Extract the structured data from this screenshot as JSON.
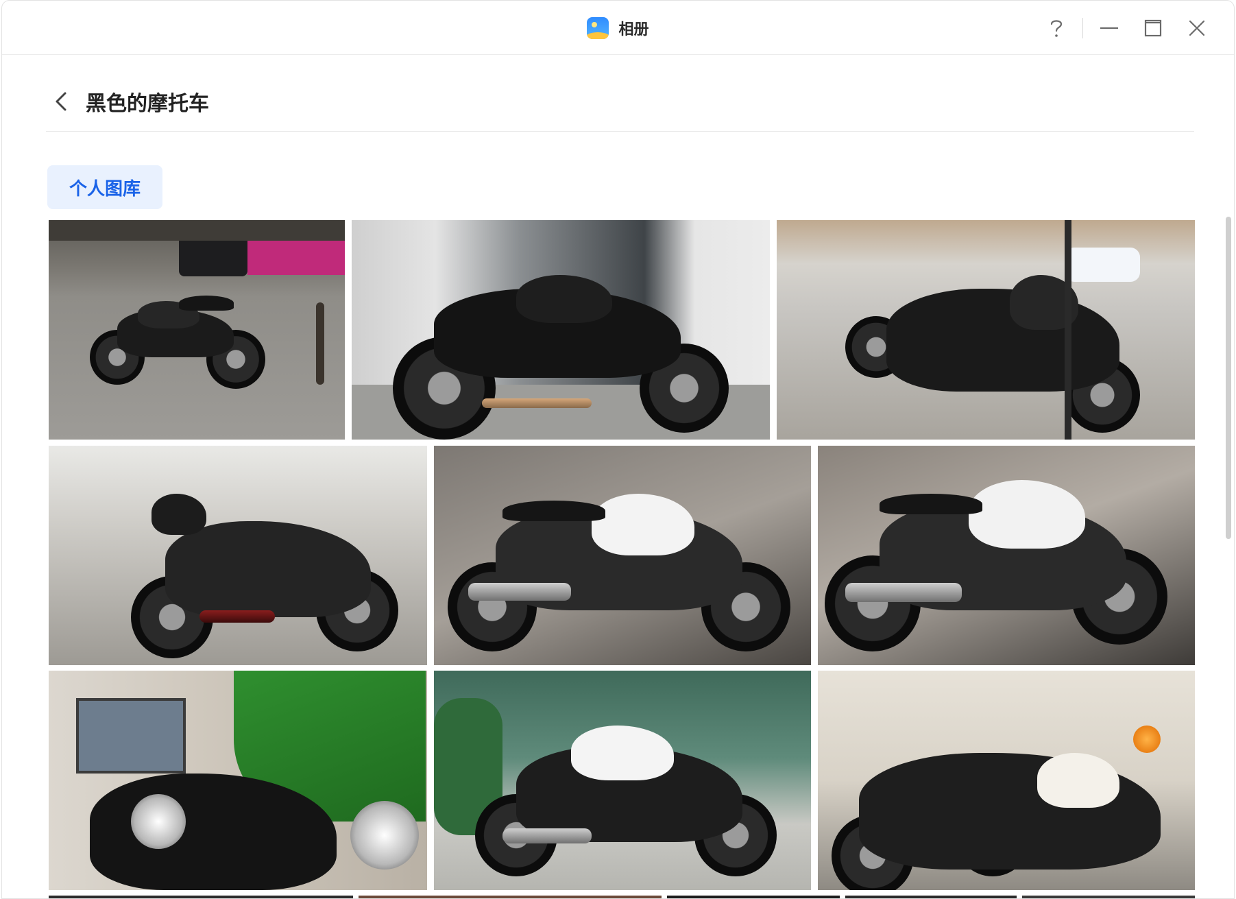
{
  "window": {
    "app_title": "相册",
    "app_icon": "photos-app-icon",
    "controls": [
      {
        "name": "help-button",
        "icon": "question-icon"
      },
      {
        "name": "minimize-button",
        "icon": "minimize-icon"
      },
      {
        "name": "maximize-button",
        "icon": "maximize-icon"
      },
      {
        "name": "close-button",
        "icon": "close-icon"
      }
    ]
  },
  "header": {
    "back_icon": "chevron-left-icon",
    "title": "黑色的摩托车"
  },
  "filter": {
    "chip_label": "个人图库",
    "active": true
  },
  "photos": {
    "subject": "motorcycle",
    "row_count_visible": 4,
    "items": [
      {
        "id": "p1",
        "scene": "street-black-sport-bike"
      },
      {
        "id": "p2",
        "scene": "black-bmw-by-pillar"
      },
      {
        "id": "p3",
        "scene": "parked-black-scooters"
      },
      {
        "id": "p4",
        "scene": "black-bike-with-topcase"
      },
      {
        "id": "p5",
        "scene": "white-bmw-k1300r"
      },
      {
        "id": "p6",
        "scene": "white-bmw-k1300r-closeup"
      },
      {
        "id": "p7",
        "scene": "green-fairing-bike-indoor"
      },
      {
        "id": "p8",
        "scene": "white-honda-naked-bike"
      },
      {
        "id": "p9",
        "scene": "cruisers-in-garage"
      },
      {
        "id": "p10",
        "scene": "partial-row"
      },
      {
        "id": "p11",
        "scene": "partial-row"
      },
      {
        "id": "p12",
        "scene": "partial-row"
      },
      {
        "id": "p13",
        "scene": "partial-row"
      },
      {
        "id": "p14",
        "scene": "partial-row"
      }
    ]
  },
  "colors": {
    "accent": "#1a63e8",
    "chip_bg": "#e9f1fe",
    "title_text": "#222222"
  }
}
